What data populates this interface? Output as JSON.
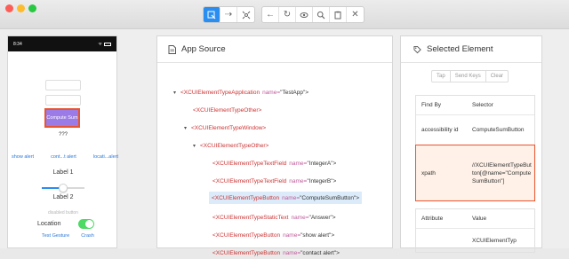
{
  "toolbar": {
    "buttons": [
      "select-element",
      "swipe",
      "tap-coordinates",
      "back",
      "refresh",
      "search-for-element",
      "search",
      "copy-xml",
      "quit-session"
    ]
  },
  "phone": {
    "time": "8:34",
    "compute_label": "Compute Sum",
    "answer": "???",
    "alerts": [
      "show alert",
      "cont...t alert",
      "locati...alert"
    ],
    "label1": "Label 1",
    "label2": "Label 2",
    "slider_value": 0.5,
    "disabled_button": "disabled button",
    "location_label": "Location",
    "location_toggle_on": true,
    "links": [
      "Test Gesture",
      "Crash"
    ]
  },
  "source": {
    "title": "App Source",
    "nodes": [
      {
        "caret": "▾",
        "tag": "<XCUIElementTypeApplication",
        "attr": "name=",
        "val": "\"TestApp\">",
        "selected": false
      },
      {
        "caret": "",
        "tag": "<XCUIElementTypeOther>",
        "attr": "",
        "val": "",
        "selected": false
      },
      {
        "caret": "▾",
        "tag": "<XCUIElementTypeWindow>",
        "attr": "",
        "val": "",
        "selected": false
      },
      {
        "caret": "▾",
        "tag": "<XCUIElementTypeOther>",
        "attr": "",
        "val": "",
        "selected": false
      },
      {
        "caret": "",
        "tag": "<XCUIElementTypeTextField",
        "attr": "name=",
        "val": "\"IntegerA\">",
        "selected": false
      },
      {
        "caret": "",
        "tag": "<XCUIElementTypeTextField",
        "attr": "name=",
        "val": "\"IntegerB\">",
        "selected": false
      },
      {
        "caret": "",
        "tag": "<XCUIElementTypeButton",
        "attr": "name=",
        "val": "\"ComputeSumButton\">",
        "selected": true
      },
      {
        "caret": "",
        "tag": "<XCUIElementTypeStaticText",
        "attr": "name=",
        "val": "\"Answer\">",
        "selected": false
      },
      {
        "caret": "",
        "tag": "<XCUIElementTypeButton",
        "attr": "name=",
        "val": "\"show alert\">",
        "selected": false
      },
      {
        "caret": "",
        "tag": "<XCUIElementTypeButton",
        "attr": "name=",
        "val": "\"contact alert\">",
        "selected": false
      }
    ]
  },
  "selected": {
    "title": "Selected Element",
    "actions": [
      "Tap",
      "Send Keys",
      "Clear"
    ],
    "find_header": [
      "Find By",
      "Selector"
    ],
    "find_rows": [
      {
        "by": "accessibility id",
        "selector": "ComputeSumButton",
        "highlight": false
      },
      {
        "by": "xpath",
        "selector": "//XCUIElementTypeButton[@name=\"ComputeSumButton\"]",
        "highlight": true
      }
    ],
    "attr_header": [
      "Attribute",
      "Value"
    ],
    "attr_rows": [
      {
        "attr": "",
        "value": "XCUIElementTyp"
      }
    ]
  }
}
